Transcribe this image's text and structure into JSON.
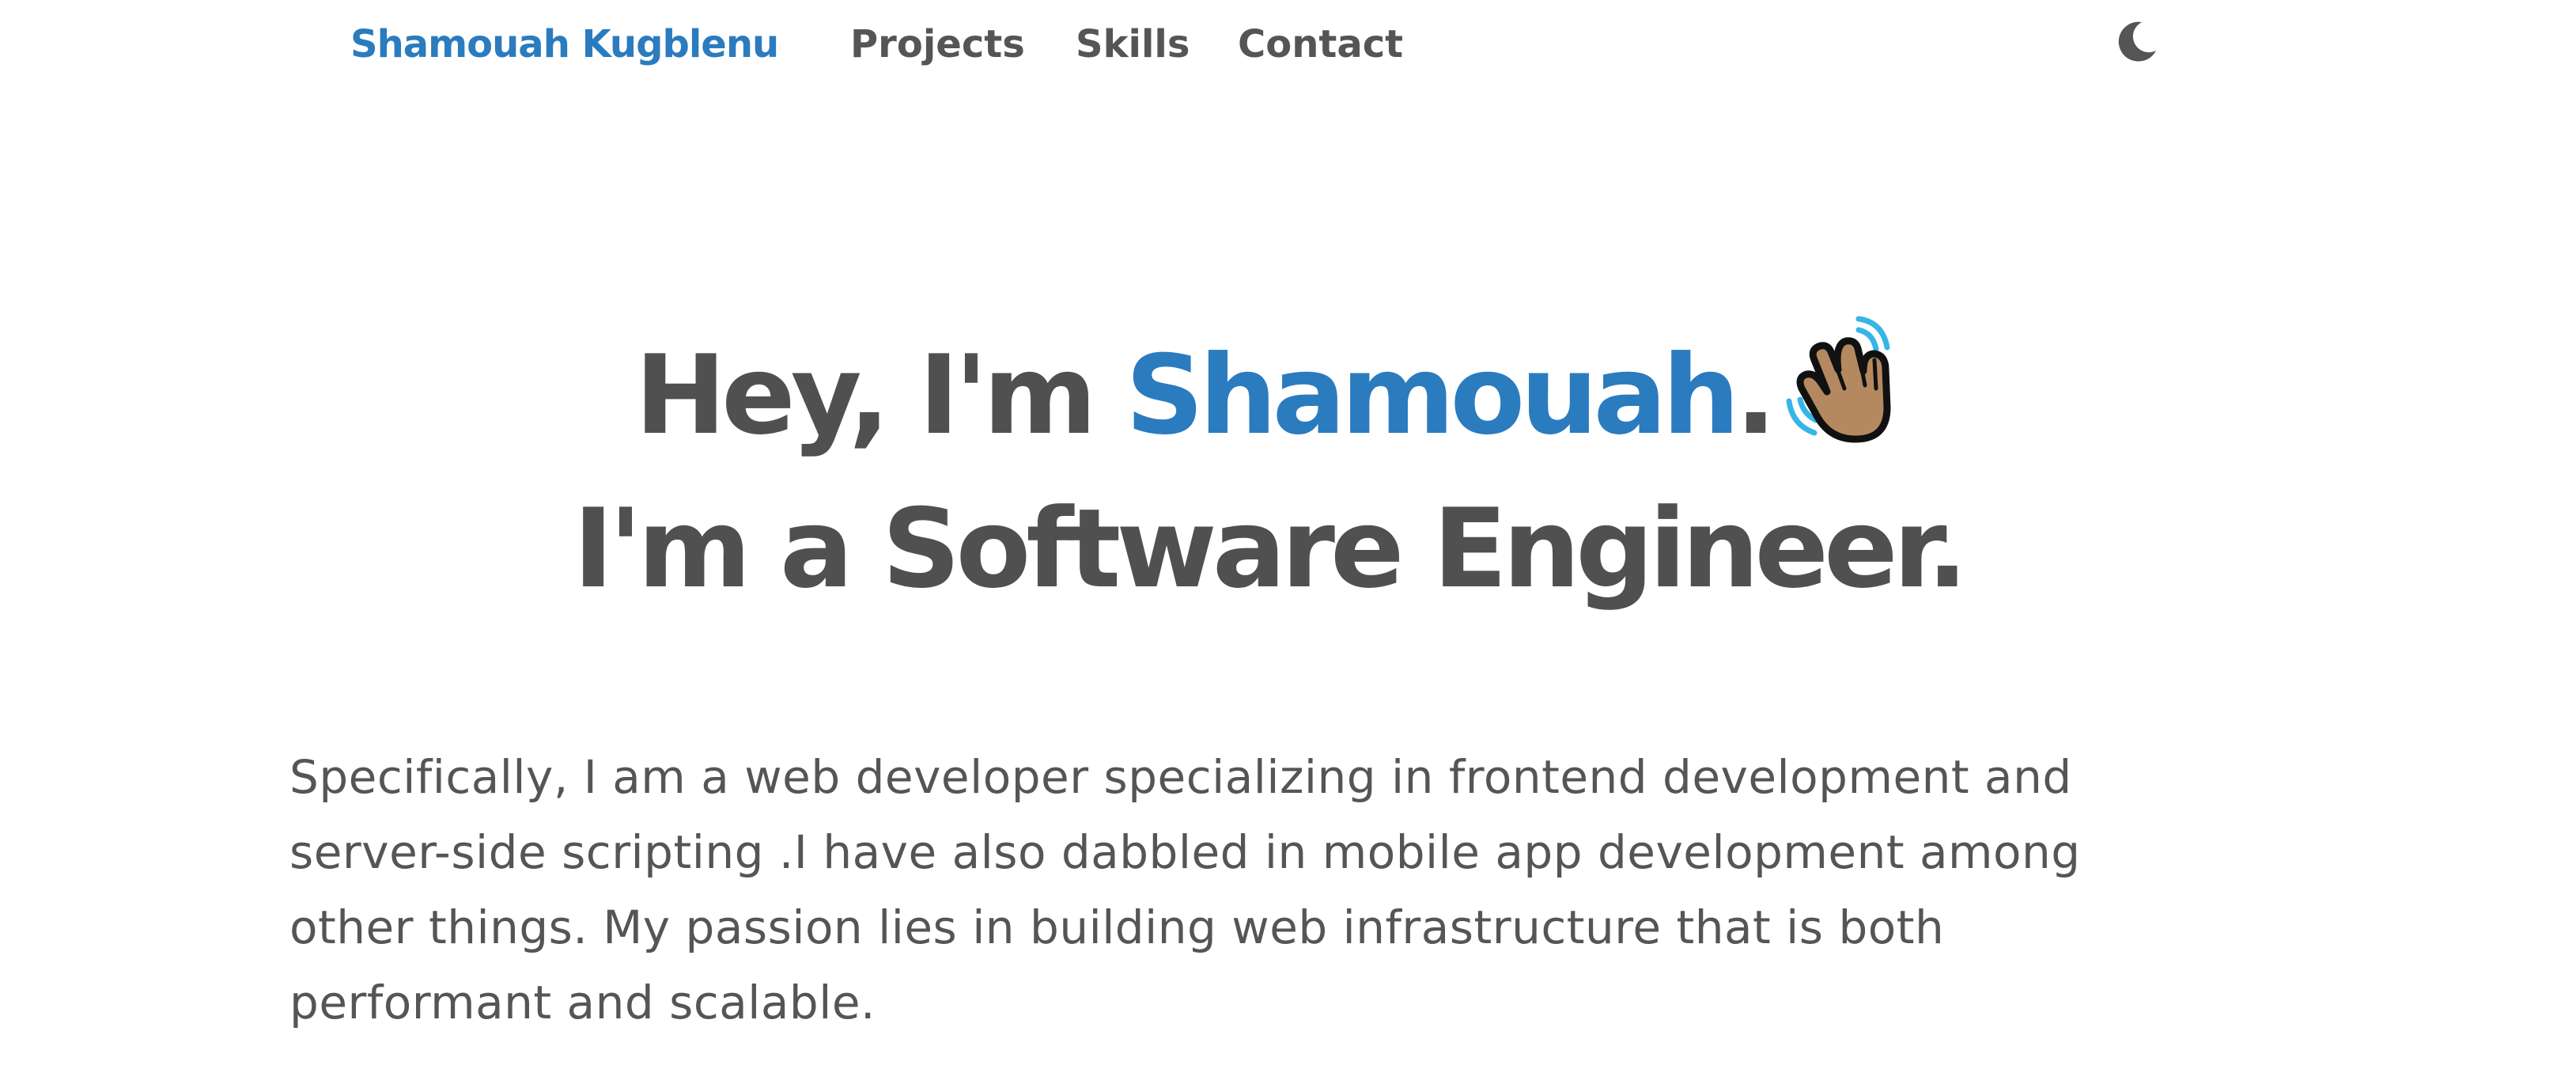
{
  "nav": {
    "brand": "Shamouah Kugblenu",
    "links": [
      {
        "label": "Projects"
      },
      {
        "label": "Skills"
      },
      {
        "label": "Contact"
      }
    ],
    "theme_toggle_icon": "moon-icon"
  },
  "hero": {
    "greeting": "Hey, I'm ",
    "name": "Shamouah",
    "punctuation": ".",
    "wave_icon": "waving-hand-icon",
    "subtitle": "I'm a Software Engineer."
  },
  "intro": {
    "text": "Specifically, I am a web developer specializing in frontend development and server-side scripting .I have also dabbled in mobile app development among other things. My passion lies in building web infrastructure that is both performant and scalable."
  },
  "colors": {
    "accent": "#2b7bbf",
    "text": "#505050",
    "background": "#ffffff"
  }
}
